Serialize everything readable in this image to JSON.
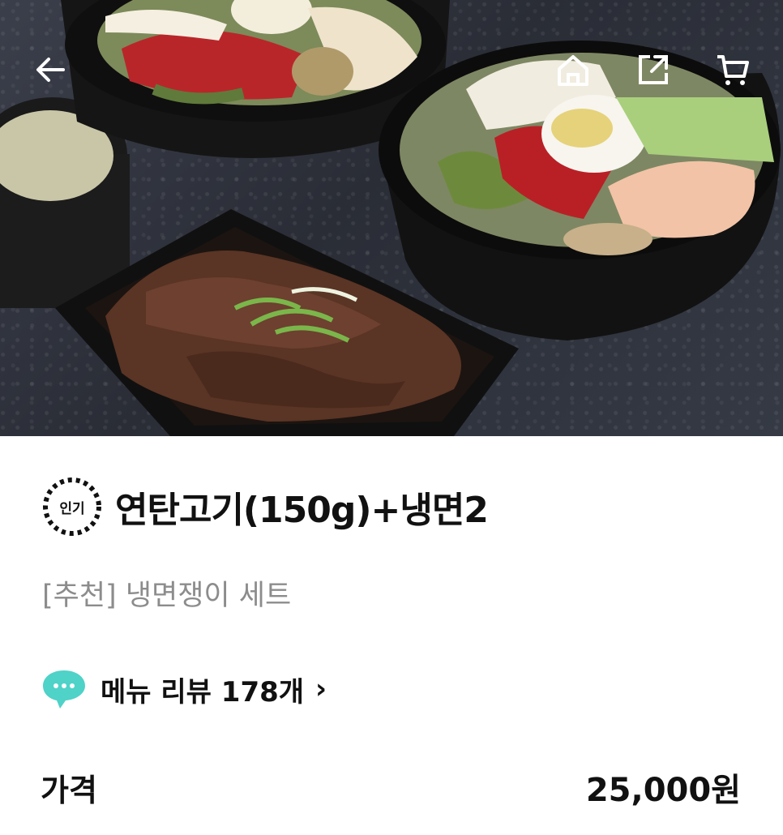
{
  "header": {
    "icons": [
      "back-arrow-icon",
      "home-icon",
      "share-icon",
      "cart-icon"
    ]
  },
  "product": {
    "badge": "인기",
    "title": "연탄고기(150g)+냉면2",
    "subtitle": "[추천] 냉면쟁이 세트",
    "review_label": "메뉴 리뷰 178개",
    "price_label": "가격",
    "price_value": "25,000원"
  },
  "colors": {
    "badge_ring": "#111111",
    "review_icon": "#4fd2c8",
    "subtitle": "#8c8c8c"
  }
}
